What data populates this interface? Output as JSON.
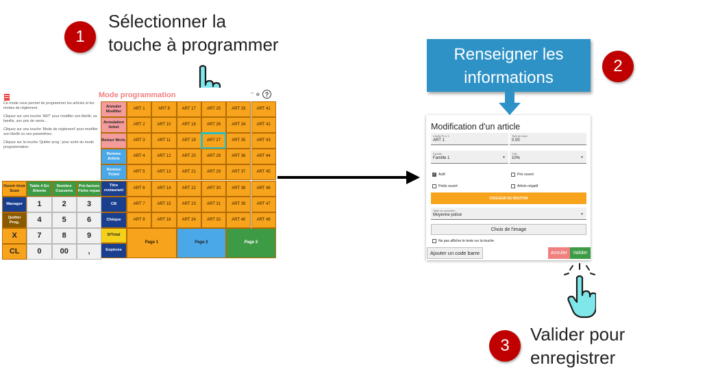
{
  "steps": [
    {
      "number": "1",
      "text_line1": "Sélectionner la",
      "text_line2": "touche à programmer"
    },
    {
      "number": "2",
      "text_line1": "Renseigner les",
      "text_line2": "informations"
    },
    {
      "number": "3",
      "text_line1": "Valider pour",
      "text_line2": "enregistrer"
    }
  ],
  "pos": {
    "title": "Mode programmation",
    "help": [
      "Ce mode vous permet de programmer les articles et les modes de règlement.",
      "Cliquez sur une touche 'ART' pour modifier son libellé, sa famille, son prix de vente...",
      "Cliquez sur une touche 'Mode de règlement' pour modifier son libellé ou ses paramètres.",
      "Cliquez sur la touche 'Quitter prog.' pour sortir du mode programmation."
    ],
    "side_buttons": [
      "Annuler Modifier",
      "Annulation ticket",
      "Retour Mrch.",
      "Remise Article",
      "Remise Ticket",
      "Titre restaurant",
      "CB",
      "Chèque",
      "S/Total",
      "Espèces"
    ],
    "art_columns": [
      [
        "ART 1",
        "ART 2",
        "ART 3",
        "ART 4",
        "ART 5",
        "ART 6",
        "ART 7",
        "ART 8"
      ],
      [
        "ART 9",
        "ART 10",
        "ART 11",
        "ART 12",
        "ART 13",
        "ART 14",
        "ART 15",
        "ART 16"
      ],
      [
        "ART 17",
        "ART 18",
        "ART 19",
        "ART 20",
        "ART 21",
        "ART 22",
        "ART 23",
        "ART 24"
      ],
      [
        "ART 25",
        "ART 26",
        "ART 27",
        "ART 28",
        "ART 29",
        "ART 30",
        "ART 31",
        "ART 32"
      ],
      [
        "ART 33",
        "ART 34",
        "ART 35",
        "ART 36",
        "ART 37",
        "ART 38",
        "ART 39",
        "ART 40"
      ],
      [
        "ART 41",
        "ART 42",
        "ART 43",
        "ART 44",
        "ART 45",
        "ART 46",
        "ART 47",
        "ART 48"
      ]
    ],
    "top_keys": [
      "Ouvrir tiroir Scan",
      "Table # En Attente",
      "Nombre Couverts",
      "Pré-facture Fiche repas"
    ],
    "left_keys": [
      "Manager",
      "Quitter Prog.",
      "X",
      "CL"
    ],
    "numpad": [
      [
        "1",
        "2",
        "3"
      ],
      [
        "4",
        "5",
        "6"
      ],
      [
        "7",
        "8",
        "9"
      ],
      [
        "0",
        "00",
        ","
      ]
    ],
    "pages": [
      "Page 1",
      "Page 2",
      "Page 3"
    ],
    "selected_key": "ART 27"
  },
  "callout": {
    "line1": "Renseigner les",
    "line2": "informations"
  },
  "modal": {
    "title": "Modification d'un article",
    "libelle_label": "Libellé PLU 1",
    "libelle_value": "ART 1",
    "tarif_label": "Tarif de base",
    "tarif_value": "0.00",
    "famille_label": "Famille",
    "famille_value": "Famille 1",
    "tva_label": "TVA",
    "tva_value": "10%",
    "chk_actif": "Actif",
    "chk_prix_ouvert": "Prix ouvert",
    "chk_poids_ouvert": "Poids ouvert",
    "chk_article_negatif": "Article négatif",
    "couleur_button": "COULEUR DU BOUTON",
    "taille_label": "Taille du caractère",
    "taille_value": "Moyenne police",
    "choix_image": "Choix de l'image",
    "chk_ne_pas_afficher": "Ne pas afficher le texte sur la touche",
    "barcode_button": "Ajouter un code barre",
    "annuler_button": "Annuler",
    "valider_button": "Valider"
  },
  "colors": {
    "badge": "#c00000",
    "callout": "#2e92c6",
    "art_key": "#f7a31c",
    "selection": "#2bbcc0",
    "hand": "#7fe6ea"
  }
}
